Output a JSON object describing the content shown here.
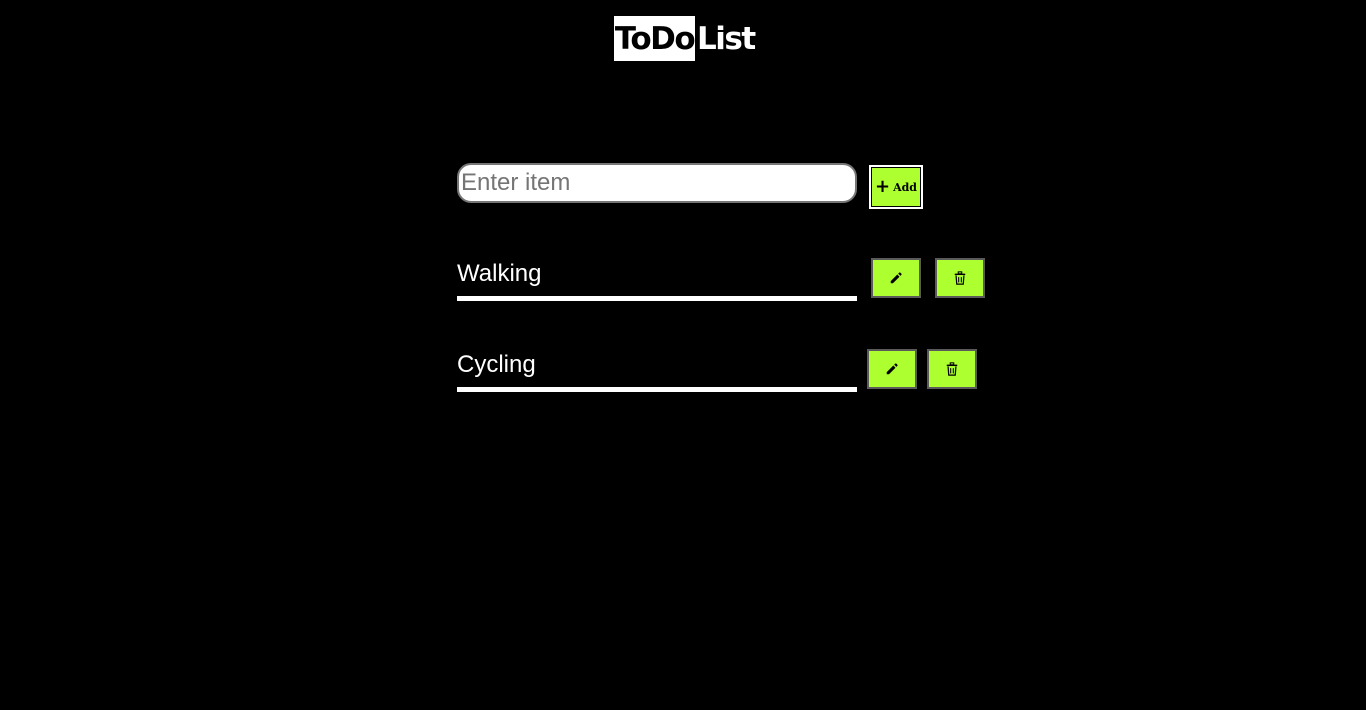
{
  "header": {
    "title_highlight": "ToDo",
    "title_rest": "List"
  },
  "input": {
    "placeholder": "Enter item",
    "value": ""
  },
  "add_button": {
    "icon": "plus-icon",
    "label": "Add"
  },
  "todos": [
    {
      "text": "Walking",
      "edit_icon": "pencil-icon",
      "delete_icon": "trash-icon"
    },
    {
      "text": "Cycling",
      "edit_icon": "pencil-icon",
      "delete_icon": "trash-icon"
    }
  ],
  "colors": {
    "background": "#000000",
    "accent": "#adff2f",
    "text": "#ffffff"
  }
}
